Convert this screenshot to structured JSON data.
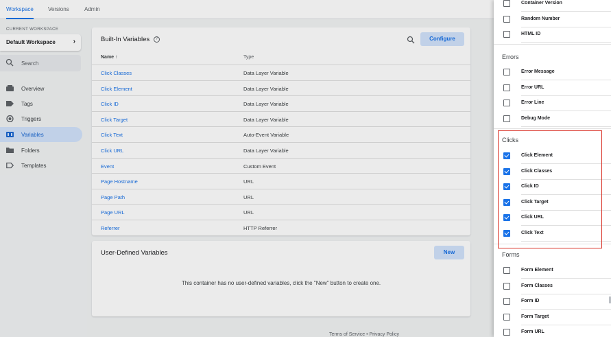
{
  "topnav": {
    "tabs": [
      "Workspace",
      "Versions",
      "Admin"
    ]
  },
  "sidebar": {
    "workspace_caption": "CURRENT WORKSPACE",
    "workspace_name": "Default Workspace",
    "search_placeholder": "Search",
    "items": [
      {
        "label": "Overview",
        "icon": "overview-icon"
      },
      {
        "label": "Tags",
        "icon": "tag-icon"
      },
      {
        "label": "Triggers",
        "icon": "trigger-icon"
      },
      {
        "label": "Variables",
        "icon": "variables-icon",
        "active": true
      },
      {
        "label": "Folders",
        "icon": "folder-icon"
      },
      {
        "label": "Templates",
        "icon": "template-icon"
      }
    ]
  },
  "builtin": {
    "title": "Built-In Variables",
    "configure_label": "Configure",
    "col_name": "Name",
    "col_type": "Type",
    "rows": [
      {
        "name": "Click Classes",
        "type": "Data Layer Variable"
      },
      {
        "name": "Click Element",
        "type": "Data Layer Variable"
      },
      {
        "name": "Click ID",
        "type": "Data Layer Variable"
      },
      {
        "name": "Click Target",
        "type": "Data Layer Variable"
      },
      {
        "name": "Click Text",
        "type": "Auto-Event Variable"
      },
      {
        "name": "Click URL",
        "type": "Data Layer Variable"
      },
      {
        "name": "Event",
        "type": "Custom Event"
      },
      {
        "name": "Page Hostname",
        "type": "URL"
      },
      {
        "name": "Page Path",
        "type": "URL"
      },
      {
        "name": "Page URL",
        "type": "URL"
      },
      {
        "name": "Referrer",
        "type": "HTTP Referrer"
      }
    ]
  },
  "user_defined": {
    "title": "User-Defined Variables",
    "new_label": "New",
    "empty_message": "This container has no user-defined variables, click the \"New\" button to create one."
  },
  "footer": {
    "text": "Terms of Service  •  Privacy Policy"
  },
  "panel": {
    "top_items": [
      {
        "label": "Container Version",
        "checked": false
      },
      {
        "label": "Random Number",
        "checked": false
      },
      {
        "label": "HTML ID",
        "checked": false
      }
    ],
    "sections": [
      {
        "title": "Errors",
        "items": [
          {
            "label": "Error Message",
            "checked": false
          },
          {
            "label": "Error URL",
            "checked": false
          },
          {
            "label": "Error Line",
            "checked": false
          },
          {
            "label": "Debug Mode",
            "checked": false
          }
        ]
      },
      {
        "title": "Clicks",
        "highlighted": true,
        "items": [
          {
            "label": "Click Element",
            "checked": true
          },
          {
            "label": "Click Classes",
            "checked": true
          },
          {
            "label": "Click ID",
            "checked": true
          },
          {
            "label": "Click Target",
            "checked": true
          },
          {
            "label": "Click URL",
            "checked": true
          },
          {
            "label": "Click Text",
            "checked": true
          }
        ]
      },
      {
        "title": "Forms",
        "items": [
          {
            "label": "Form Element",
            "checked": false
          },
          {
            "label": "Form Classes",
            "checked": false
          },
          {
            "label": "Form ID",
            "checked": false
          },
          {
            "label": "Form Target",
            "checked": false
          },
          {
            "label": "Form URL",
            "checked": false
          }
        ]
      }
    ]
  },
  "colors": {
    "accent": "#1a73e8",
    "active_nav_bg": "#d2e3fc",
    "highlight_border": "#d93025"
  }
}
